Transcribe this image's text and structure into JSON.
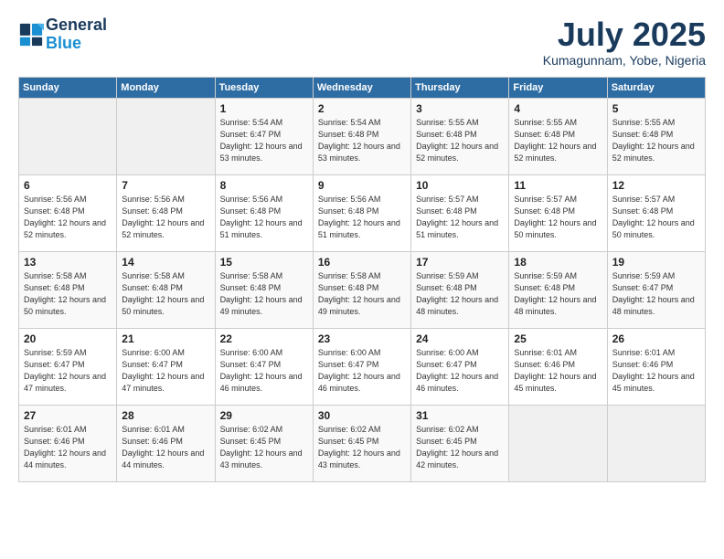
{
  "header": {
    "logo_line1": "General",
    "logo_line2": "Blue",
    "month": "July 2025",
    "location": "Kumagunnam, Yobe, Nigeria"
  },
  "weekdays": [
    "Sunday",
    "Monday",
    "Tuesday",
    "Wednesday",
    "Thursday",
    "Friday",
    "Saturday"
  ],
  "weeks": [
    [
      {
        "day": "",
        "empty": true
      },
      {
        "day": "",
        "empty": true
      },
      {
        "day": "1",
        "sunrise": "5:54 AM",
        "sunset": "6:47 PM",
        "daylight": "12 hours and 53 minutes."
      },
      {
        "day": "2",
        "sunrise": "5:54 AM",
        "sunset": "6:48 PM",
        "daylight": "12 hours and 53 minutes."
      },
      {
        "day": "3",
        "sunrise": "5:55 AM",
        "sunset": "6:48 PM",
        "daylight": "12 hours and 52 minutes."
      },
      {
        "day": "4",
        "sunrise": "5:55 AM",
        "sunset": "6:48 PM",
        "daylight": "12 hours and 52 minutes."
      },
      {
        "day": "5",
        "sunrise": "5:55 AM",
        "sunset": "6:48 PM",
        "daylight": "12 hours and 52 minutes."
      }
    ],
    [
      {
        "day": "6",
        "sunrise": "5:56 AM",
        "sunset": "6:48 PM",
        "daylight": "12 hours and 52 minutes."
      },
      {
        "day": "7",
        "sunrise": "5:56 AM",
        "sunset": "6:48 PM",
        "daylight": "12 hours and 52 minutes."
      },
      {
        "day": "8",
        "sunrise": "5:56 AM",
        "sunset": "6:48 PM",
        "daylight": "12 hours and 51 minutes."
      },
      {
        "day": "9",
        "sunrise": "5:56 AM",
        "sunset": "6:48 PM",
        "daylight": "12 hours and 51 minutes."
      },
      {
        "day": "10",
        "sunrise": "5:57 AM",
        "sunset": "6:48 PM",
        "daylight": "12 hours and 51 minutes."
      },
      {
        "day": "11",
        "sunrise": "5:57 AM",
        "sunset": "6:48 PM",
        "daylight": "12 hours and 50 minutes."
      },
      {
        "day": "12",
        "sunrise": "5:57 AM",
        "sunset": "6:48 PM",
        "daylight": "12 hours and 50 minutes."
      }
    ],
    [
      {
        "day": "13",
        "sunrise": "5:58 AM",
        "sunset": "6:48 PM",
        "daylight": "12 hours and 50 minutes."
      },
      {
        "day": "14",
        "sunrise": "5:58 AM",
        "sunset": "6:48 PM",
        "daylight": "12 hours and 50 minutes."
      },
      {
        "day": "15",
        "sunrise": "5:58 AM",
        "sunset": "6:48 PM",
        "daylight": "12 hours and 49 minutes."
      },
      {
        "day": "16",
        "sunrise": "5:58 AM",
        "sunset": "6:48 PM",
        "daylight": "12 hours and 49 minutes."
      },
      {
        "day": "17",
        "sunrise": "5:59 AM",
        "sunset": "6:48 PM",
        "daylight": "12 hours and 48 minutes."
      },
      {
        "day": "18",
        "sunrise": "5:59 AM",
        "sunset": "6:48 PM",
        "daylight": "12 hours and 48 minutes."
      },
      {
        "day": "19",
        "sunrise": "5:59 AM",
        "sunset": "6:47 PM",
        "daylight": "12 hours and 48 minutes."
      }
    ],
    [
      {
        "day": "20",
        "sunrise": "5:59 AM",
        "sunset": "6:47 PM",
        "daylight": "12 hours and 47 minutes."
      },
      {
        "day": "21",
        "sunrise": "6:00 AM",
        "sunset": "6:47 PM",
        "daylight": "12 hours and 47 minutes."
      },
      {
        "day": "22",
        "sunrise": "6:00 AM",
        "sunset": "6:47 PM",
        "daylight": "12 hours and 46 minutes."
      },
      {
        "day": "23",
        "sunrise": "6:00 AM",
        "sunset": "6:47 PM",
        "daylight": "12 hours and 46 minutes."
      },
      {
        "day": "24",
        "sunrise": "6:00 AM",
        "sunset": "6:47 PM",
        "daylight": "12 hours and 46 minutes."
      },
      {
        "day": "25",
        "sunrise": "6:01 AM",
        "sunset": "6:46 PM",
        "daylight": "12 hours and 45 minutes."
      },
      {
        "day": "26",
        "sunrise": "6:01 AM",
        "sunset": "6:46 PM",
        "daylight": "12 hours and 45 minutes."
      }
    ],
    [
      {
        "day": "27",
        "sunrise": "6:01 AM",
        "sunset": "6:46 PM",
        "daylight": "12 hours and 44 minutes."
      },
      {
        "day": "28",
        "sunrise": "6:01 AM",
        "sunset": "6:46 PM",
        "daylight": "12 hours and 44 minutes."
      },
      {
        "day": "29",
        "sunrise": "6:02 AM",
        "sunset": "6:45 PM",
        "daylight": "12 hours and 43 minutes."
      },
      {
        "day": "30",
        "sunrise": "6:02 AM",
        "sunset": "6:45 PM",
        "daylight": "12 hours and 43 minutes."
      },
      {
        "day": "31",
        "sunrise": "6:02 AM",
        "sunset": "6:45 PM",
        "daylight": "12 hours and 42 minutes."
      },
      {
        "day": "",
        "empty": true
      },
      {
        "day": "",
        "empty": true
      }
    ]
  ]
}
